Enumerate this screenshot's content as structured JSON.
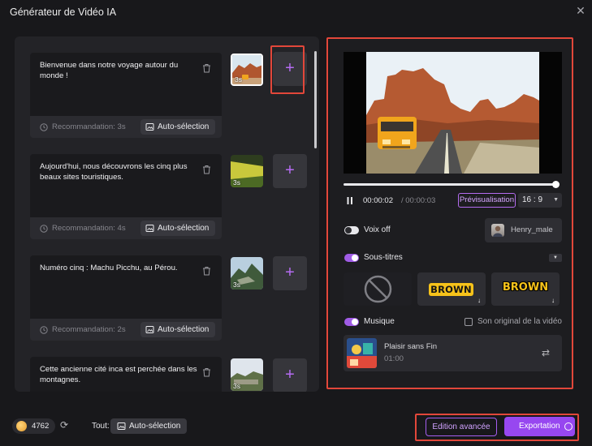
{
  "window": {
    "title": "Générateur de Vidéo IA"
  },
  "scenes": [
    {
      "text": "Bienvenue dans notre voyage autour du monde !",
      "recommendation": "Recommandation: 3s",
      "auto_label": "Auto-sélection",
      "duration": "3s"
    },
    {
      "text": "Aujourd'hui, nous découvrons les cinq plus beaux sites touristiques.",
      "recommendation": "Recommandation: 4s",
      "auto_label": "Auto-sélection",
      "duration": "3s"
    },
    {
      "text": "Numéro cinq : Machu Picchu, au Pérou.",
      "recommendation": "Recommandation: 2s",
      "auto_label": "Auto-sélection",
      "duration": "3s"
    },
    {
      "text": "Cette ancienne cité inca est perchée dans les montagnes.",
      "recommendation": "",
      "auto_label": "",
      "duration": "3s"
    }
  ],
  "player": {
    "time_current": "00:00:02",
    "time_total": "/ 00:00:03",
    "progress": 1.0,
    "preview_label": "Prévisualisation",
    "aspect_ratio": "16 : 9"
  },
  "voice": {
    "label": "Voix off",
    "enabled": false,
    "voice_name": "Henry_male"
  },
  "subtitles": {
    "label": "Sous-titres",
    "enabled": true,
    "styles": [
      "none",
      "BROWN",
      "BROWN"
    ]
  },
  "music": {
    "label": "Musique",
    "enabled": true,
    "original_sound_label": "Son original de la vidéo",
    "original_sound_checked": false,
    "track_title": "Plaisir sans Fin",
    "track_duration": "01:00"
  },
  "footer": {
    "credits": "4762",
    "all_label": "Tout:",
    "auto_label": "Auto-sélection",
    "advanced_label": "Edition avancée",
    "export_label": "Exportation"
  },
  "colors": {
    "accent": "#9747f0",
    "highlight": "#e2473a",
    "panel": "#232327"
  }
}
